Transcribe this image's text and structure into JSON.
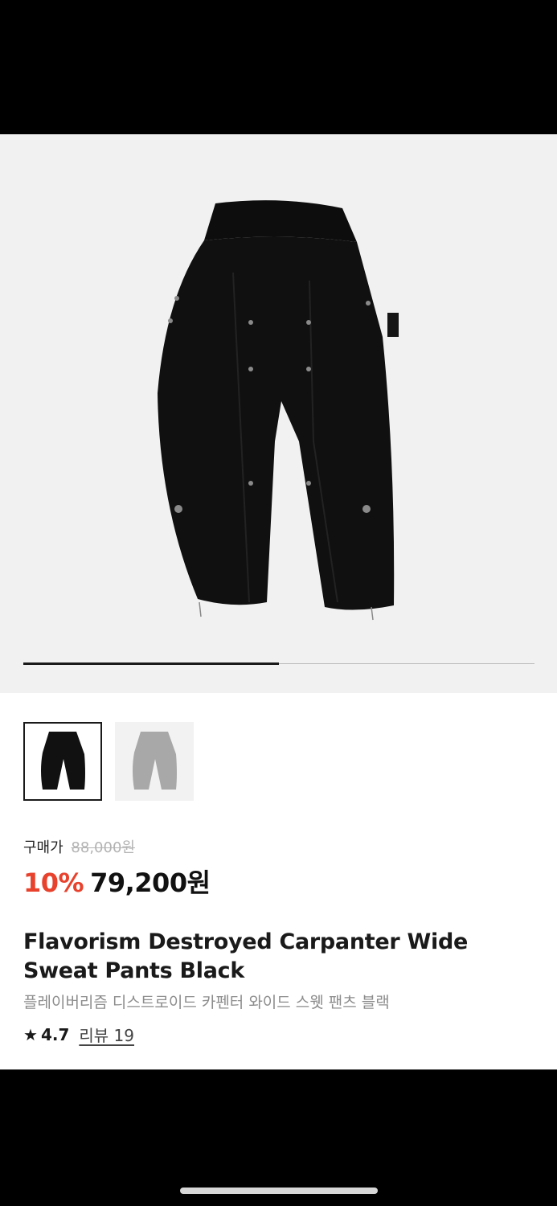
{
  "product": {
    "price_label": "구매가",
    "original_price": "88,000원",
    "discount": "10%",
    "sale_price": "79,200원",
    "title": "Flavorism Destroyed Carpanter Wide Sweat Pants Black",
    "subtitle": "플레이버리즘 디스트로이드 카펜터 와이드 스웻 팬츠 블랙",
    "rating": "4.7",
    "review_label": "리뷰 19"
  },
  "gallery": {
    "progress": 0.5,
    "thumbnails": [
      {
        "color": "black",
        "selected": true
      },
      {
        "color": "gray",
        "selected": false
      }
    ]
  },
  "icons": {
    "star": "star-icon"
  },
  "colors": {
    "discount": "#e8412c",
    "hero_bg": "#f1f1f1"
  }
}
